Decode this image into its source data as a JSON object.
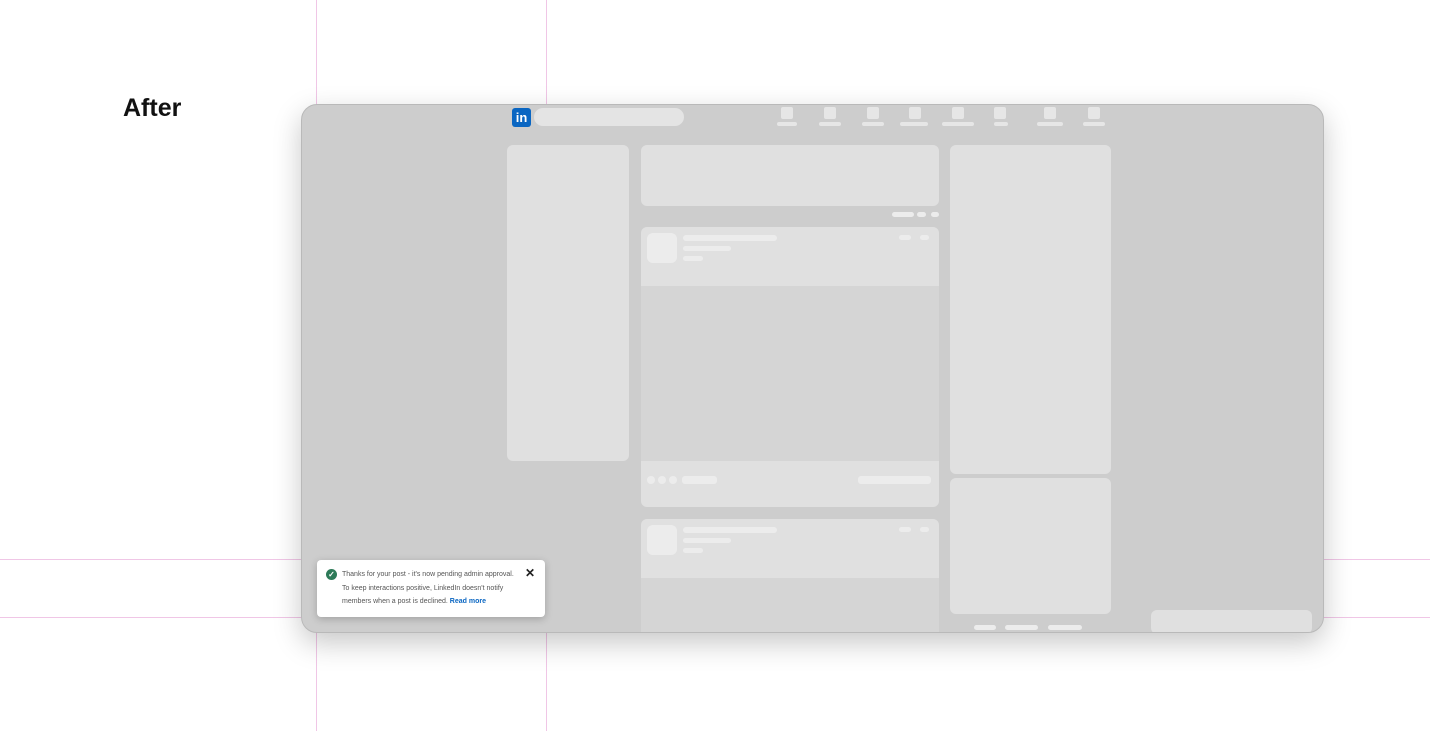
{
  "heading": "After",
  "app": {
    "logo_text": "in",
    "brand_color": "#0a66c2"
  },
  "toast": {
    "line1": "Thanks for your post - it's now pending admin approval.",
    "line2": "To keep interactions positive, LinkedIn doesn't notify",
    "line3": "members when a post is declined.",
    "link_label": "Read more",
    "close_label": "✕",
    "check_label": "✓",
    "status_color": "#2d7a58"
  }
}
